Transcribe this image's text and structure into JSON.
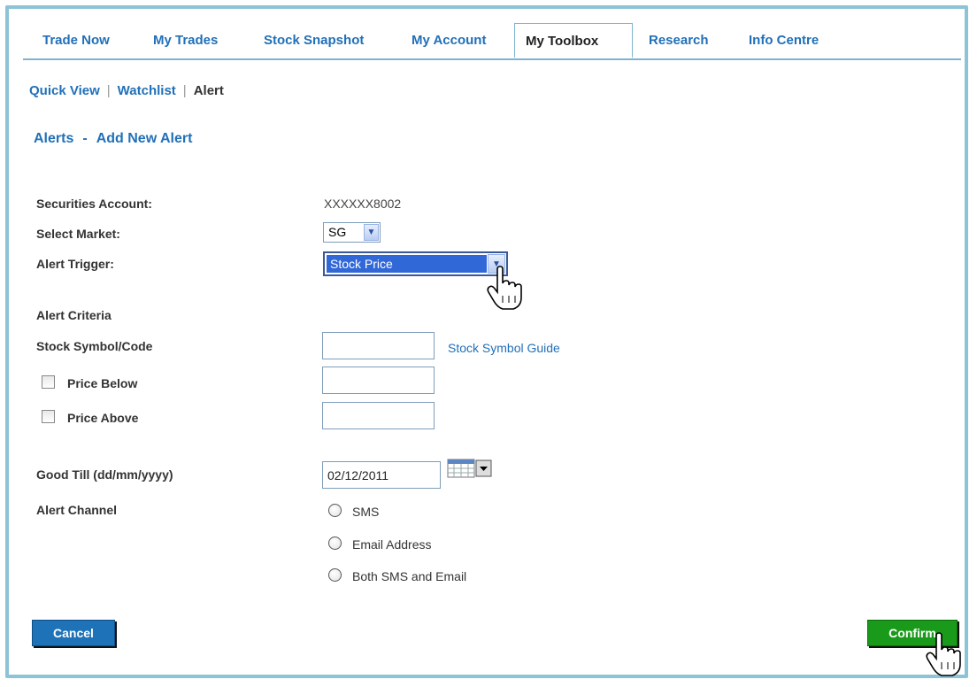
{
  "tabs": [
    {
      "label": "Trade Now"
    },
    {
      "label": "My Trades"
    },
    {
      "label": "Stock Snapshot"
    },
    {
      "label": "My Account"
    },
    {
      "label": "My Toolbox"
    },
    {
      "label": "Research"
    },
    {
      "label": "Info Centre"
    }
  ],
  "active_tab": "My Toolbox",
  "subnav": {
    "quick_view": "Quick View",
    "watchlist": "Watchlist",
    "alert": "Alert",
    "separator": "|"
  },
  "heading": {
    "alerts": "Alerts",
    "dash": "-",
    "add_new": "Add New Alert"
  },
  "form": {
    "securities_account_label": "Securities Account:",
    "securities_account_value": "XXXXXX8002",
    "select_market_label": "Select Market:",
    "select_market_value": "SG",
    "alert_trigger_label": "Alert Trigger:",
    "alert_trigger_value": "Stock Price",
    "alert_criteria_label": "Alert Criteria",
    "stock_symbol_label": "Stock Symbol/Code",
    "stock_symbol_value": "",
    "stock_symbol_guide": "Stock Symbol Guide",
    "price_below_label": "Price Below",
    "price_below_value": "",
    "price_above_label": "Price Above",
    "price_above_value": "",
    "good_till_label": "Good Till (dd/mm/yyyy)",
    "good_till_value": "02/12/2011",
    "alert_channel_label": "Alert Channel",
    "channel_options": [
      "SMS",
      "Email Address",
      "Both SMS and Email"
    ]
  },
  "buttons": {
    "cancel": "Cancel",
    "confirm": "Confirm"
  },
  "colors": {
    "link": "#2170b8",
    "confirm": "#1a9a1a",
    "cancel": "#1e72b8",
    "frame": "#8cc3d6"
  },
  "icons": [
    "calendar-icon",
    "dropdown-arrow-icon",
    "hand-cursor-icon"
  ]
}
